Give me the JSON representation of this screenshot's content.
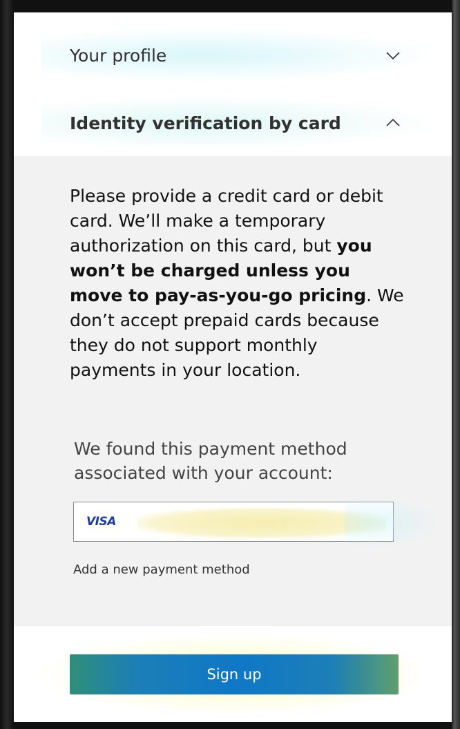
{
  "accordion": {
    "profile_label": "Your profile",
    "identity_label": "Identity verification by card"
  },
  "identity": {
    "text_part1": "Please provide a credit card or debit card. We’ll make a temporary authorization on this card, but ",
    "text_bold": "you won’t be charged unless you move to pay-as-you-go pricing",
    "text_part2": ". We don’t accept prepaid cards because they do not support monthly payments in your location.",
    "found_text": "We found this payment method associated with your account:",
    "card_brand": "VISA",
    "add_payment_label": "Add a new payment method"
  },
  "footer": {
    "signup_label": "Sign up"
  },
  "icons": {
    "profile_chevron": "chevron-down-icon",
    "identity_chevron": "chevron-up-icon"
  },
  "colors": {
    "signup_bg": "#0f78c7",
    "visa_blue": "#1a3ea0"
  }
}
